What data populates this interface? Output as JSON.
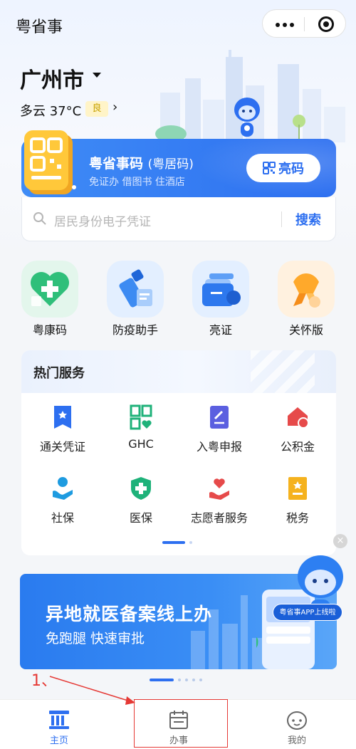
{
  "header": {
    "app_title": "粤省事"
  },
  "location": {
    "city": "广州市",
    "weather": "多云 37°C",
    "aqi": "良",
    "arrow": "›"
  },
  "code_card": {
    "title": "粤省事码",
    "title_suffix": "(粤居码)",
    "subtitle": "免证办 借图书 住酒店",
    "button_label": "亮码"
  },
  "search": {
    "placeholder": "居民身份电子凭证",
    "button_label": "搜索"
  },
  "quick_tiles": [
    {
      "label": "粤康码",
      "icon": "health-code-icon"
    },
    {
      "label": "防疫助手",
      "icon": "epidemic-helper-icon"
    },
    {
      "label": "亮证",
      "icon": "license-icon"
    },
    {
      "label": "关怀版",
      "icon": "care-edition-icon"
    }
  ],
  "hot_services": {
    "title": "热门服务",
    "items": [
      {
        "label": "通关凭证",
        "icon": "customs-pass-icon"
      },
      {
        "label": "GHC",
        "icon": "ghc-icon"
      },
      {
        "label": "入粤申报",
        "icon": "entry-declaration-icon"
      },
      {
        "label": "公积金",
        "icon": "housing-fund-icon"
      },
      {
        "label": "社保",
        "icon": "social-security-icon"
      },
      {
        "label": "医保",
        "icon": "medical-insurance-icon"
      },
      {
        "label": "志愿者服务",
        "icon": "volunteer-icon"
      },
      {
        "label": "税务",
        "icon": "tax-icon"
      }
    ]
  },
  "banner": {
    "title": "异地就医备案线上办",
    "subtitle": "免跑腿  快速审批",
    "tag": "粤省事APP上线啦",
    "close": "×"
  },
  "annotation": {
    "label": "1、"
  },
  "tabbar": [
    {
      "label": "主页",
      "icon": "home-icon",
      "active": true
    },
    {
      "label": "办事",
      "icon": "calendar-icon",
      "active": false
    },
    {
      "label": "我的",
      "icon": "mascot-face-icon",
      "active": false
    }
  ],
  "colors": {
    "primary": "#2d6ff0",
    "annotation": "#e53935"
  }
}
